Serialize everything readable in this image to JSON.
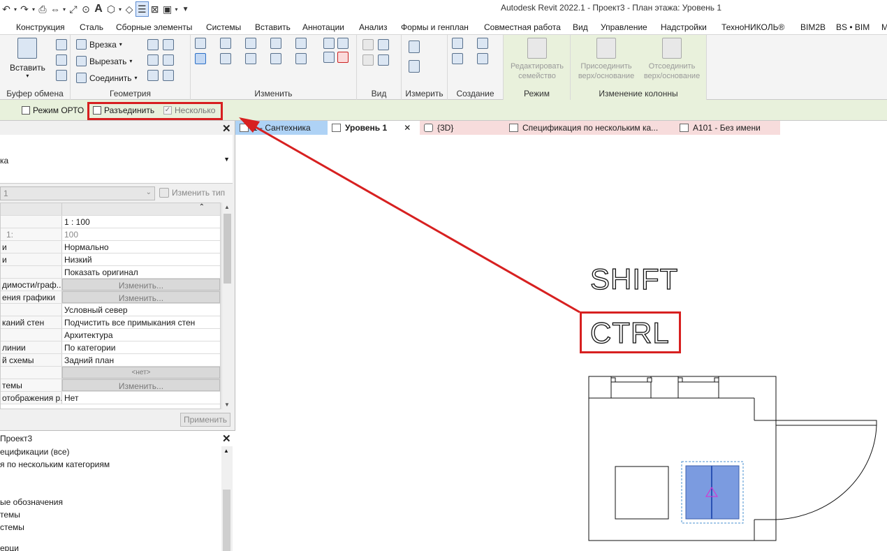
{
  "app_title": "Autodesk Revit 2022.1 - Проект3 - План этажа: Уровень 1",
  "qat": {
    "text_icon": "A"
  },
  "ribbon_tabs": [
    "Конструкция",
    "Сталь",
    "Сборные элементы",
    "Системы",
    "Вставить",
    "Аннотации",
    "Анализ",
    "Формы и генплан",
    "Совместная работа",
    "Вид",
    "Управление",
    "Надстройки",
    "ТехноНИКОЛЬ®",
    "BIM2B",
    "BS • BIM",
    "М"
  ],
  "panels": {
    "clipboard": {
      "name": "Буфер обмена",
      "paste": "Вставить"
    },
    "geometry": {
      "name": "Геометрия",
      "cope": "Врезка",
      "cut": "Вырезать",
      "join": "Соединить"
    },
    "modify": {
      "name": "Изменить"
    },
    "view": {
      "name": "Вид"
    },
    "measure": {
      "name": "Измерить"
    },
    "create": {
      "name": "Создание"
    },
    "mode": {
      "name": "Режим",
      "edit_family": "Редактировать семейство"
    },
    "column": {
      "name": "Изменение колонны",
      "attach": "Присоединить верх/основание",
      "detach": "Отсоединить верх/основание"
    }
  },
  "options": {
    "ortho": "Режим ОРТО",
    "disjoin": "Разъединить",
    "multiple": "Несколько",
    "multiple_checked": true,
    "multiple_check_mark": "✓"
  },
  "properties": {
    "type_name": "ка",
    "type_selector": "1",
    "edit_type": "Изменить тип",
    "apply": "Применить",
    "rows": [
      {
        "k": "",
        "v": "1 : 100"
      },
      {
        "k": "1:",
        "v": "100",
        "gray": true
      },
      {
        "k": "и",
        "v": "Нормально"
      },
      {
        "k": "и",
        "v": "Низкий"
      },
      {
        "k": "",
        "v": "Показать оригинал"
      },
      {
        "k": "димости/граф...",
        "v": "Изменить...",
        "btn": true
      },
      {
        "k": "ения графики",
        "v": "Изменить...",
        "btn": true
      },
      {
        "k": "",
        "v": "Условный север"
      },
      {
        "k": "каний стен",
        "v": "Подчистить все примыкания стен"
      },
      {
        "k": "",
        "v": "Архитектура"
      },
      {
        "k": "линии",
        "v": "По категории"
      },
      {
        "k": "й схемы",
        "v": "Задний план"
      },
      {
        "k": "",
        "v": "<нет>",
        "btn": true
      },
      {
        "k": "темы",
        "v": "Изменить...",
        "btn": true
      },
      {
        "k": "отображения р...",
        "v": "Нет"
      }
    ]
  },
  "browser": {
    "title": "Проект3",
    "items": [
      "ецификации (все)",
      "я по нескольким категориям",
      "",
      "ые обозначения",
      "темы",
      "стемы",
      "",
      "ерци"
    ]
  },
  "view_tabs": [
    {
      "label": "1 - Сантехника"
    },
    {
      "label": "Уровень 1"
    },
    {
      "label": "{3D}"
    },
    {
      "label": "Спецификация по нескольким ка..."
    },
    {
      "label": "А101 - Без имени"
    }
  ],
  "canvas": {
    "key_shift": "SHIFT",
    "key_ctrl": "CTRL"
  },
  "colors": {
    "highlight": "#d72020",
    "options_bar": "#e8f1dc",
    "active_tab": "#aed2f5",
    "pink_tab": "#f7dcdc",
    "selection": "#7b9be0"
  }
}
